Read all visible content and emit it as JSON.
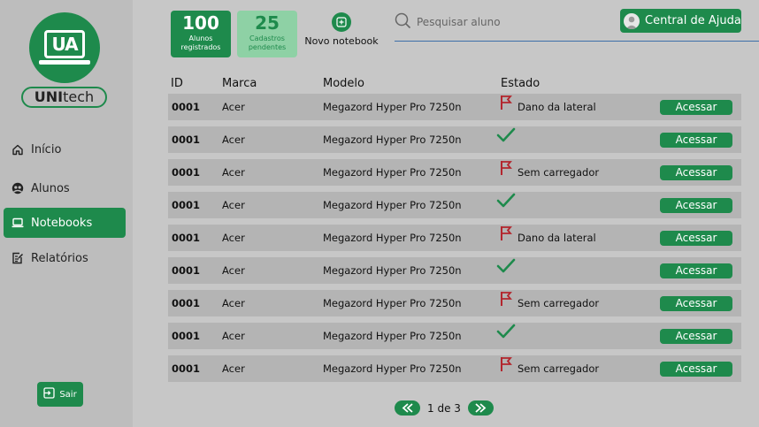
{
  "brand": {
    "logo_text": "UA",
    "name_bold": "UNI",
    "name_rest": "tech"
  },
  "sidebar": {
    "items": [
      {
        "label": "Início",
        "icon": "home-icon"
      },
      {
        "label": "Alunos",
        "icon": "users-icon"
      },
      {
        "label": "Notebooks",
        "icon": "laptop-icon",
        "active": true
      },
      {
        "label": "Relatórios",
        "icon": "report-icon"
      }
    ],
    "logout_label": "Sair"
  },
  "stats": {
    "registered": {
      "value": "100",
      "label_line1": "Alunos",
      "label_line2": "registrados"
    },
    "pending": {
      "value": "25",
      "label_line1": "Cadastros",
      "label_line2": "pendentes"
    }
  },
  "new_notebook": {
    "label": "Novo notebook",
    "icon": "add-notebook-icon"
  },
  "search": {
    "placeholder": "Pesquisar aluno",
    "icon": "search-icon"
  },
  "help": {
    "label": "Central de Ajuda",
    "icon": "avatar-icon"
  },
  "table": {
    "headers": {
      "id": "ID",
      "brand": "Marca",
      "model": "Modelo",
      "state": "Estado"
    },
    "action_label": "Acessar",
    "rows": [
      {
        "id": "0001",
        "brand": "Acer",
        "model": "Megazord Hyper Pro 7250n",
        "state": "Dano da lateral",
        "status": "flag"
      },
      {
        "id": "0001",
        "brand": "Acer",
        "model": "Megazord Hyper Pro 7250n",
        "state": "",
        "status": "ok"
      },
      {
        "id": "0001",
        "brand": "Acer",
        "model": "Megazord Hyper Pro 7250n",
        "state": "Sem carregador",
        "status": "flag"
      },
      {
        "id": "0001",
        "brand": "Acer",
        "model": "Megazord Hyper Pro 7250n",
        "state": "",
        "status": "ok"
      },
      {
        "id": "0001",
        "brand": "Acer",
        "model": "Megazord Hyper Pro 7250n",
        "state": "Dano da lateral",
        "status": "flag"
      },
      {
        "id": "0001",
        "brand": "Acer",
        "model": "Megazord Hyper Pro 7250n",
        "state": "",
        "status": "ok"
      },
      {
        "id": "0001",
        "brand": "Acer",
        "model": "Megazord Hyper Pro 7250n",
        "state": "Sem carregador",
        "status": "flag"
      },
      {
        "id": "0001",
        "brand": "Acer",
        "model": "Megazord Hyper Pro 7250n",
        "state": "",
        "status": "ok"
      },
      {
        "id": "0001",
        "brand": "Acer",
        "model": "Megazord Hyper Pro 7250n",
        "state": "Sem carregador",
        "status": "flag"
      }
    ]
  },
  "pagination": {
    "label": "1 de 3",
    "prev_icon": "double-chevron-left-icon",
    "next_icon": "double-chevron-right-icon"
  },
  "colors": {
    "accent": "#1e8a4c",
    "accent_light": "#8ed1a5",
    "flag": "#b3262e",
    "check": "#1e8a4c"
  }
}
